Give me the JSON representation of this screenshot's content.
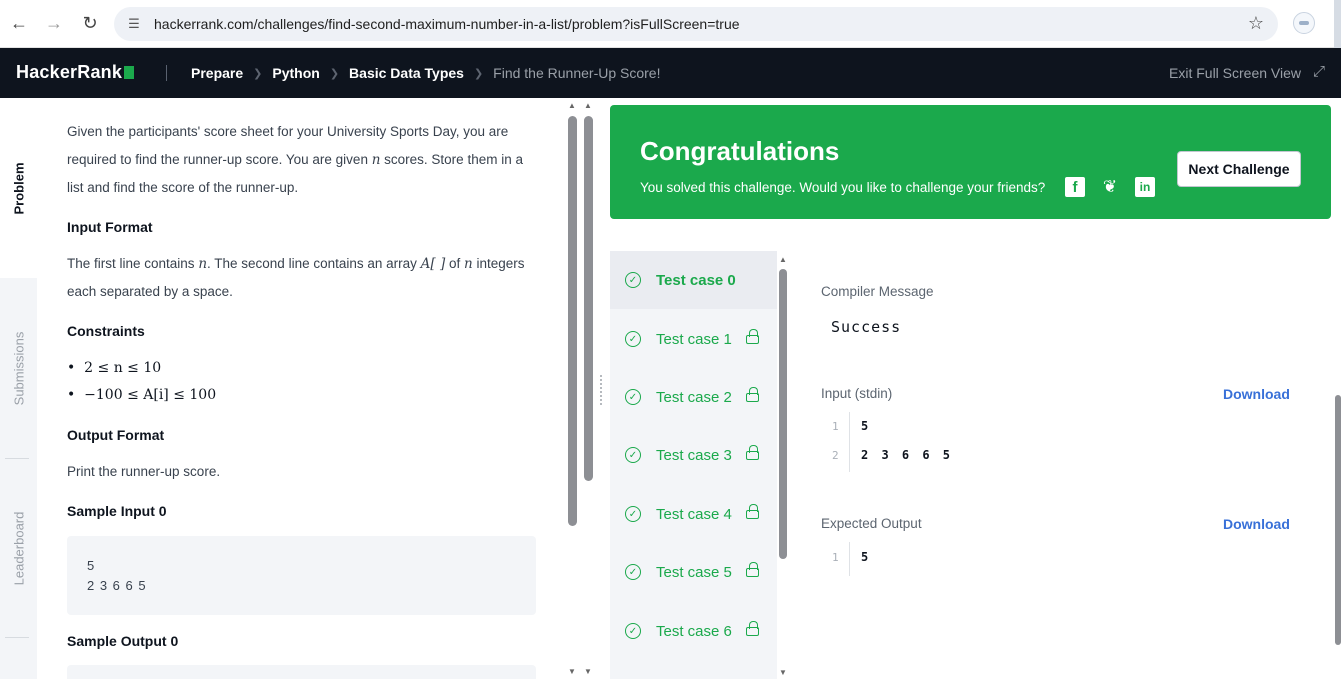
{
  "browser": {
    "url": "hackerrank.com/challenges/find-second-maximum-number-in-a-list/problem?isFullScreen=true",
    "icons": [
      "back-arrow-icon",
      "forward-arrow-icon",
      "reload-icon",
      "site-info-icon",
      "bookmark-star-icon",
      "profile-icon"
    ]
  },
  "topbar": {
    "logo": "HackerRank",
    "breadcrumbs": [
      "Prepare",
      "Python",
      "Basic Data Types",
      "Find the Runner-Up Score!"
    ],
    "exit_label": "Exit Full Screen View"
  },
  "side_tabs": {
    "problem": "Problem",
    "submissions": "Submissions",
    "leaderboard": "Leaderboard"
  },
  "problem": {
    "intro": [
      "Given the participants' score sheet for your University Sports Day, you are",
      "required to find the runner-up score. You are given ",
      "n",
      " scores. Store them in a",
      "list and find the score of the runner-up."
    ],
    "input_format_title": "Input Format",
    "input_format": [
      "The first line contains ",
      "n",
      ". The second line contains an array ",
      "A[ ]",
      " of ",
      "n",
      " integers",
      "each separated by a space."
    ],
    "constraints_title": "Constraints",
    "constraints": [
      "2 ≤ n ≤ 10",
      "−100 ≤ A[i] ≤ 100"
    ],
    "output_format_title": "Output Format",
    "output_format": "Print the runner-up score.",
    "sample_input_title": "Sample Input 0",
    "sample_input": [
      "5",
      "2 3 6 6 5"
    ],
    "sample_output_title": "Sample Output 0"
  },
  "result": {
    "title": "Congratulations",
    "message": "You solved this challenge. Would you like to challenge your friends?",
    "share_icons": [
      "facebook-icon",
      "twitter-icon",
      "linkedin-icon"
    ],
    "next_button": "Next Challenge",
    "accent": "#1ba94c"
  },
  "test_cases": [
    {
      "label": "Test case 0",
      "locked": false
    },
    {
      "label": "Test case 1",
      "locked": true
    },
    {
      "label": "Test case 2",
      "locked": true
    },
    {
      "label": "Test case 3",
      "locked": true
    },
    {
      "label": "Test case 4",
      "locked": true
    },
    {
      "label": "Test case 5",
      "locked": true
    },
    {
      "label": "Test case 6",
      "locked": true
    }
  ],
  "details": {
    "compiler_label": "Compiler Message",
    "compiler_message": "Success",
    "input_label": "Input (stdin)",
    "download": "Download",
    "input_lines": [
      {
        "n": "1",
        "v": "5"
      },
      {
        "n": "2",
        "v": "2 3 6 6 5"
      }
    ],
    "expected_label": "Expected Output",
    "expected_lines": [
      {
        "n": "1",
        "v": "5"
      }
    ]
  }
}
